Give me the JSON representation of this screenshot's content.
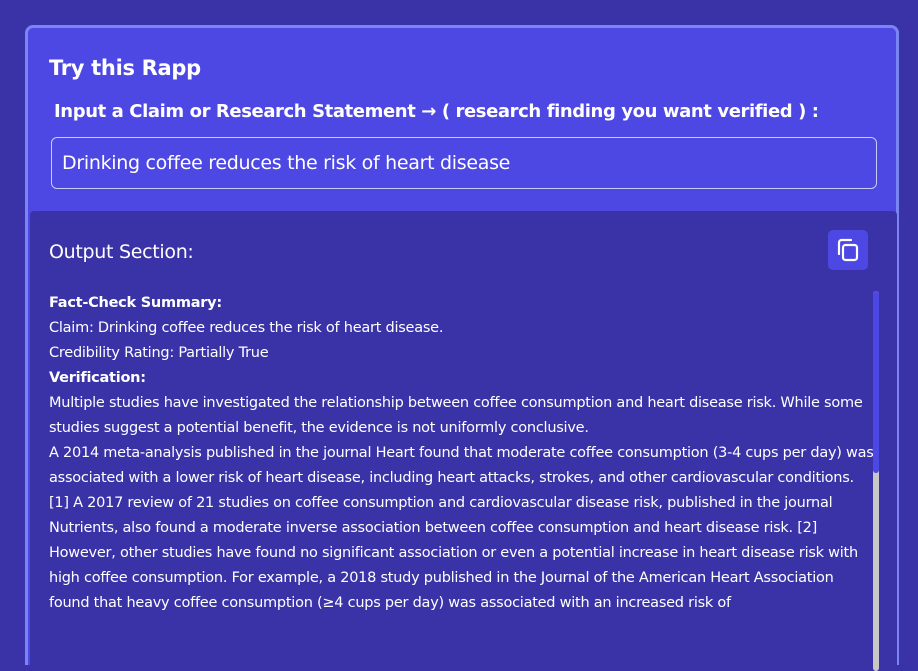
{
  "card": {
    "title": "Try this Rapp",
    "input_label": "Input a Claim or Research Statement → ( research finding you want verified ) :",
    "input_value": "Drinking coffee reduces the risk of heart disease"
  },
  "output": {
    "title": "Output Section:",
    "copy_icon": "copy-icon",
    "lines": [
      {
        "text": "Fact-Check Summary:",
        "bold": true
      },
      {
        "text": "Claim: Drinking coffee reduces the risk of heart disease.",
        "bold": false
      },
      {
        "text": "Credibility Rating: Partially True",
        "bold": false
      },
      {
        "text": "Verification:",
        "bold": true
      },
      {
        "text": "Multiple studies have investigated the relationship between coffee consumption and heart disease risk. While some studies suggest a potential benefit, the evidence is not uniformly conclusive.",
        "bold": false
      },
      {
        "text": "A 2014 meta-analysis published in the journal Heart found that moderate coffee consumption (3-4 cups per day) was associated with a lower risk of heart disease, including heart attacks, strokes, and other cardiovascular conditions. [1] A 2017 review of 21 studies on coffee consumption and cardiovascular disease risk, published in the journal Nutrients, also found a moderate inverse association between coffee consumption and heart disease risk. [2]",
        "bold": false
      },
      {
        "text": "However, other studies have found no significant association or even a potential increase in heart disease risk with high coffee consumption. For example, a 2018 study published in the Journal of the American Heart Association found that heavy coffee consumption (≥4 cups per day) was associated with an increased risk of",
        "bold": false
      }
    ]
  },
  "colors": {
    "page_background": "#3a33a8",
    "card_background": "#4d47e3",
    "card_border": "#7b84f5",
    "text": "#ffffff"
  }
}
